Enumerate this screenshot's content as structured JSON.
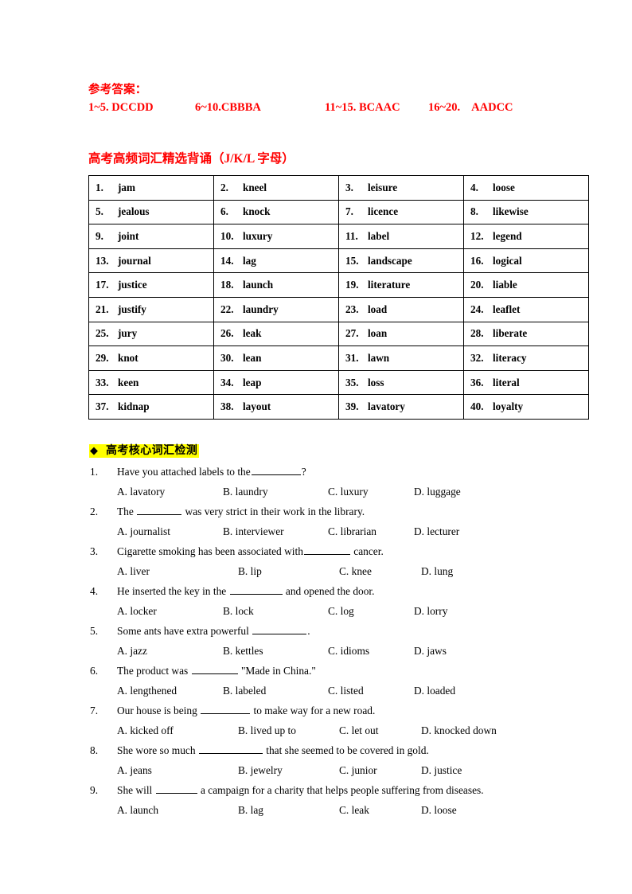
{
  "answers": {
    "title": "参考答案：",
    "groups": [
      {
        "range": "1~5. DCCDD"
      },
      {
        "range": "6~10.CBBBA"
      },
      {
        "range": "11~15. BCAAC"
      },
      {
        "range": "16~20.",
        "value": "AADCC"
      }
    ]
  },
  "vocab_section": {
    "heading": "高考高频词汇精选背诵（J/K/L 字母）",
    "words": [
      {
        "num": "1.",
        "word": "jam"
      },
      {
        "num": "2.",
        "word": "kneel"
      },
      {
        "num": "3.",
        "word": "leisure"
      },
      {
        "num": "4.",
        "word": "loose"
      },
      {
        "num": "5.",
        "word": "jealous"
      },
      {
        "num": "6.",
        "word": "knock"
      },
      {
        "num": "7.",
        "word": "licence"
      },
      {
        "num": "8.",
        "word": "likewise"
      },
      {
        "num": "9.",
        "word": "joint"
      },
      {
        "num": "10.",
        "word": "luxury"
      },
      {
        "num": "11.",
        "word": "label"
      },
      {
        "num": "12.",
        "word": "legend"
      },
      {
        "num": "13.",
        "word": "journal"
      },
      {
        "num": "14.",
        "word": "lag"
      },
      {
        "num": "15.",
        "word": "landscape"
      },
      {
        "num": "16.",
        "word": "logical"
      },
      {
        "num": "17.",
        "word": "justice"
      },
      {
        "num": "18.",
        "word": "launch"
      },
      {
        "num": "19.",
        "word": "literature"
      },
      {
        "num": "20.",
        "word": "liable"
      },
      {
        "num": "21.",
        "word": "justify"
      },
      {
        "num": "22.",
        "word": "laundry"
      },
      {
        "num": "23.",
        "word": "load"
      },
      {
        "num": "24.",
        "word": "leaflet"
      },
      {
        "num": "25.",
        "word": "jury"
      },
      {
        "num": "26.",
        "word": "leak"
      },
      {
        "num": "27.",
        "word": "loan"
      },
      {
        "num": "28.",
        "word": "liberate"
      },
      {
        "num": "29.",
        "word": "knot"
      },
      {
        "num": "30.",
        "word": "lean"
      },
      {
        "num": "31.",
        "word": "lawn"
      },
      {
        "num": "32.",
        "word": "literacy"
      },
      {
        "num": "33.",
        "word": "keen"
      },
      {
        "num": "34.",
        "word": "leap"
      },
      {
        "num": "35.",
        "word": "loss"
      },
      {
        "num": "36.",
        "word": "literal"
      },
      {
        "num": "37.",
        "word": "kidnap"
      },
      {
        "num": "38.",
        "word": "layout"
      },
      {
        "num": "39.",
        "word": "lavatory"
      },
      {
        "num": "40.",
        "word": "loyalty"
      }
    ]
  },
  "quiz_section": {
    "bullet": "◆",
    "heading": "高考核心词汇检测",
    "highlight_color": "#FFFF00",
    "questions": [
      {
        "num": "1.",
        "before": "Have you attached labels to the",
        "blank_width": 62,
        "after": "?",
        "options": [
          "A. lavatory",
          "B. laundry",
          "C. luxury",
          "D. luggage"
        ]
      },
      {
        "num": "2.",
        "before": "The ",
        "blank_width": 56,
        "after": " was very strict in their work in the library.",
        "options": [
          "A. journalist",
          "B. interviewer",
          "C. librarian",
          "D. lecturer"
        ]
      },
      {
        "num": "3.",
        "before": "Cigarette smoking has been associated with",
        "blank_width": 58,
        "after": " cancer.",
        "options": [
          "A. liver",
          "B. lip",
          "C. knee",
          "D. lung"
        ]
      },
      {
        "num": "4.",
        "before": "He inserted the key in the ",
        "blank_width": 66,
        "after": " and opened the door.",
        "options": [
          "A. locker",
          "B. lock",
          "C. log",
          "D. lorry"
        ]
      },
      {
        "num": "5.",
        "before": "Some ants have extra powerful ",
        "blank_width": 68,
        "after": ".",
        "options": [
          "A. jazz",
          "B. kettles",
          "C. idioms",
          "D. jaws"
        ]
      },
      {
        "num": "6.",
        "before": "The product was ",
        "blank_width": 58,
        "after": " \"Made in China.\"",
        "options": [
          "A. lengthened",
          "B. labeled",
          "C. listed",
          "D. loaded"
        ]
      },
      {
        "num": "7.",
        "before": "Our house is being ",
        "blank_width": 62,
        "after": " to make way for a new road.",
        "options": [
          "A. kicked off",
          "B. lived up to",
          "C. let out",
          "D. knocked down"
        ]
      },
      {
        "num": "8.",
        "before": "She wore so much ",
        "blank_width": 80,
        "after": " that she seemed to be covered in gold.",
        "options": [
          "A. jeans",
          "B. jewelry",
          "C. junior",
          "D. justice"
        ]
      },
      {
        "num": "9.",
        "before": "She will ",
        "blank_width": 52,
        "after": " a campaign for a charity that helps people suffering from diseases.",
        "options": [
          "A. launch",
          "B. lag",
          "C. leak",
          "D. loose"
        ]
      }
    ]
  }
}
